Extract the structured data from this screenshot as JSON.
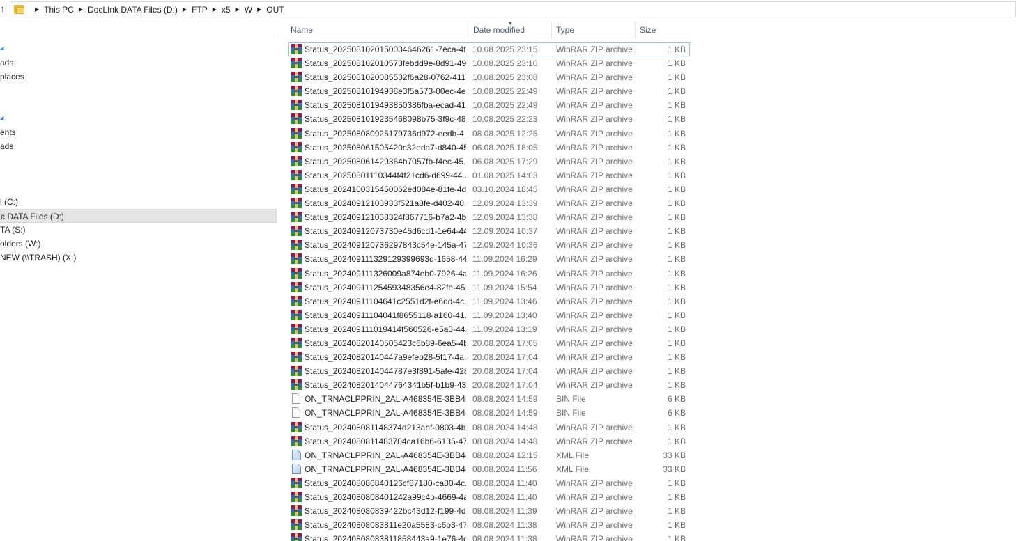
{
  "address_bar": {
    "crumbs": [
      "This PC",
      "DocLInk DATA Files (D:)",
      "FTP",
      "x5",
      "W",
      "OUT"
    ]
  },
  "nav": {
    "items": [
      {
        "label": "",
        "arrow": true
      },
      {
        "label": "ads"
      },
      {
        "label": "places"
      },
      {
        "label": "",
        "arrow": true
      },
      {
        "label": "ents"
      },
      {
        "label": "ads"
      },
      {
        "label": "l (C:)"
      },
      {
        "label": "c DATA Files (D:)",
        "selected": true
      },
      {
        "label": "TA (S:)"
      },
      {
        "label": "olders (W:)"
      },
      {
        "label": "NEW (\\\\TRASH) (X:)"
      }
    ]
  },
  "columns": {
    "name": "Name",
    "date": "Date modified",
    "type": "Type",
    "size": "Size"
  },
  "colors": {
    "header_text": "#4c607a",
    "detail_text": "#6d6d6d",
    "selection_border": "#99c2e5"
  },
  "files": [
    {
      "name": "Status_20250810201500346​46261-7eca-4f...",
      "date": "10.08.2025 23:15",
      "type": "WinRAR ZIP archive",
      "size": "1 KB",
      "icon": "rar"
    },
    {
      "name": "Status_202508102010573febdd9e-8d91-49...",
      "date": "10.08.2025 23:10",
      "type": "WinRAR ZIP archive",
      "size": "1 KB",
      "icon": "rar"
    },
    {
      "name": "Status_2025081020085532f6a28-0762-411...",
      "date": "10.08.2025 23:08",
      "type": "WinRAR ZIP archive",
      "size": "1 KB",
      "icon": "rar"
    },
    {
      "name": "Status_20250810194938e3f5a573-00ec-4e...",
      "date": "10.08.2025 22:49",
      "type": "WinRAR ZIP archive",
      "size": "1 KB",
      "icon": "rar"
    },
    {
      "name": "Status_20250810194938​50386fba-ecad-41...",
      "date": "10.08.2025 22:49",
      "type": "WinRAR ZIP archive",
      "size": "1 KB",
      "icon": "rar"
    },
    {
      "name": "Status_20250810192354​68098b75-3f9c-48...",
      "date": "10.08.2025 22:23",
      "type": "WinRAR ZIP archive",
      "size": "1 KB",
      "icon": "rar"
    },
    {
      "name": "Status_20250808092517​9736d972-eedb-4...",
      "date": "08.08.2025 12:25",
      "type": "WinRAR ZIP archive",
      "size": "1 KB",
      "icon": "rar"
    },
    {
      "name": "Status_202508061505420c32eda7-d840-45...",
      "date": "06.08.2025 18:05",
      "type": "WinRAR ZIP archive",
      "size": "1 KB",
      "icon": "rar"
    },
    {
      "name": "Status_202508061429364b7057fb-f4ec-45...",
      "date": "06.08.2025 17:29",
      "type": "WinRAR ZIP archive",
      "size": "1 KB",
      "icon": "rar"
    },
    {
      "name": "Status_20250801110344f4f21cd6-d699-44...",
      "date": "01.08.2025 14:03",
      "type": "WinRAR ZIP archive",
      "size": "1 KB",
      "icon": "rar"
    },
    {
      "name": "Status_2024100315450062ed084e-81fe-4d...",
      "date": "03.10.2024 18:45",
      "type": "WinRAR ZIP archive",
      "size": "1 KB",
      "icon": "rar"
    },
    {
      "name": "Status_20240912103933f521a8fe-d402-40...",
      "date": "12.09.2024 13:39",
      "type": "WinRAR ZIP archive",
      "size": "1 KB",
      "icon": "rar"
    },
    {
      "name": "Status_20240912103832​4f867716-b7a2-4b...",
      "date": "12.09.2024 13:38",
      "type": "WinRAR ZIP archive",
      "size": "1 KB",
      "icon": "rar"
    },
    {
      "name": "Status_20240912073730e45d6cd1-1e64-44...",
      "date": "12.09.2024 10:37",
      "type": "WinRAR ZIP archive",
      "size": "1 KB",
      "icon": "rar"
    },
    {
      "name": "Status_202409120736297843c54e-145a-47...",
      "date": "12.09.2024 10:36",
      "type": "WinRAR ZIP archive",
      "size": "1 KB",
      "icon": "rar"
    },
    {
      "name": "Status_2024091113291293​99693d-1658-44...",
      "date": "11.09.2024 16:29",
      "type": "WinRAR ZIP archive",
      "size": "1 KB",
      "icon": "rar"
    },
    {
      "name": "Status_202409111326009a874eb0-7926-4a...",
      "date": "11.09.2024 16:26",
      "type": "WinRAR ZIP archive",
      "size": "1 KB",
      "icon": "rar"
    },
    {
      "name": "Status_20240911125459348356e4-82fe-45...",
      "date": "11.09.2024 15:54",
      "type": "WinRAR ZIP archive",
      "size": "1 KB",
      "icon": "rar"
    },
    {
      "name": "Status_20240911104641c2551d2f-e6dd-4c...",
      "date": "11.09.2024 13:46",
      "type": "WinRAR ZIP archive",
      "size": "1 KB",
      "icon": "rar"
    },
    {
      "name": "Status_20240911104041f8655118-a160-41...",
      "date": "11.09.2024 13:40",
      "type": "WinRAR ZIP archive",
      "size": "1 KB",
      "icon": "rar"
    },
    {
      "name": "Status_20240911101941​4f560526-e5a3-44...",
      "date": "11.09.2024 13:19",
      "type": "WinRAR ZIP archive",
      "size": "1 KB",
      "icon": "rar"
    },
    {
      "name": "Status_20240820140505423c6b89-6ea5-4b...",
      "date": "20.08.2024 17:05",
      "type": "WinRAR ZIP archive",
      "size": "1 KB",
      "icon": "rar"
    },
    {
      "name": "Status_20240820140447a9efeb28-5f17-4a...",
      "date": "20.08.2024 17:04",
      "type": "WinRAR ZIP archive",
      "size": "1 KB",
      "icon": "rar"
    },
    {
      "name": "Status_20240820140447​87e3f891-5afe-428...",
      "date": "20.08.2024 17:04",
      "type": "WinRAR ZIP archive",
      "size": "1 KB",
      "icon": "rar"
    },
    {
      "name": "Status_20240820140447​64341b5f-b1b9-43...",
      "date": "20.08.2024 17:04",
      "type": "WinRAR ZIP archive",
      "size": "1 KB",
      "icon": "rar"
    },
    {
      "name": "ON_TRNACLPPRIN_2AL-A468354E-3BB4-...",
      "date": "08.08.2024 14:59",
      "type": "BIN File",
      "size": "6 KB",
      "icon": "bin"
    },
    {
      "name": "ON_TRNACLPPRIN_2AL-A468354E-3BB4-...",
      "date": "08.08.2024 14:59",
      "type": "BIN File",
      "size": "6 KB",
      "icon": "bin"
    },
    {
      "name": "Status_202408081148374d213abf-0803-4b...",
      "date": "08.08.2024 14:48",
      "type": "WinRAR ZIP archive",
      "size": "1 KB",
      "icon": "rar"
    },
    {
      "name": "Status_202408081148370​4ca16b6-6135-47...",
      "date": "08.08.2024 14:48",
      "type": "WinRAR ZIP archive",
      "size": "1 KB",
      "icon": "rar"
    },
    {
      "name": "ON_TRNACLPPRIN_2AL-A468354E-3BB4-...",
      "date": "08.08.2024 12:15",
      "type": "XML File",
      "size": "33 KB",
      "icon": "xml"
    },
    {
      "name": "ON_TRNACLPPRIN_2AL-A468354E-3BB4-...",
      "date": "08.08.2024 11:56",
      "type": "XML File",
      "size": "33 KB",
      "icon": "xml"
    },
    {
      "name": "Status_202408080840126cf87180-ca80-4c...",
      "date": "08.08.2024 11:40",
      "type": "WinRAR ZIP archive",
      "size": "1 KB",
      "icon": "rar"
    },
    {
      "name": "Status_2024080808401242a99c4b-4669-4a...",
      "date": "08.08.2024 11:40",
      "type": "WinRAR ZIP archive",
      "size": "1 KB",
      "icon": "rar"
    },
    {
      "name": "Status_20240808083942​2bc43d12-f199-4d...",
      "date": "08.08.2024 11:39",
      "type": "WinRAR ZIP archive",
      "size": "1 KB",
      "icon": "rar"
    },
    {
      "name": "Status_20240808083811e20a5583-c6b3-47...",
      "date": "08.08.2024 11:38",
      "type": "WinRAR ZIP archive",
      "size": "1 KB",
      "icon": "rar"
    },
    {
      "name": "Status_20240808083811858443a9-1e76-4d...",
      "date": "08.08.2024 11:38",
      "type": "WinRAR ZIP archive",
      "size": "1 KB",
      "icon": "rar"
    }
  ]
}
